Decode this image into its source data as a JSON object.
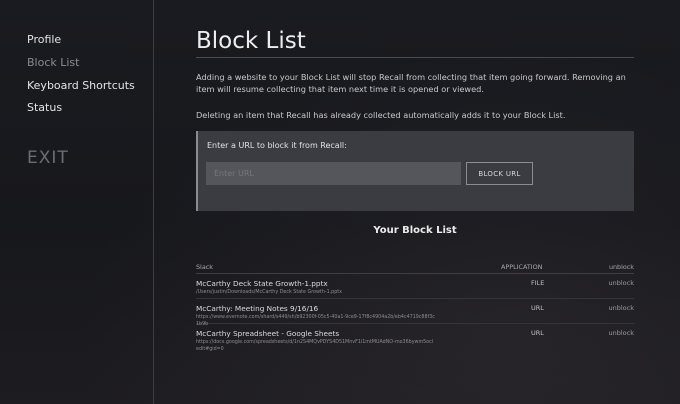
{
  "sidebar": {
    "items": [
      {
        "label": "Profile"
      },
      {
        "label": "Block List"
      },
      {
        "label": "Keyboard Shortcuts"
      },
      {
        "label": "Status"
      }
    ],
    "exit_label": "EXIT"
  },
  "main": {
    "title": "Block List",
    "description_1": "Adding a website to your Block List will stop Recall from collecting that item going forward. Removing an item will resume collecting that item next time it is opened or viewed.",
    "description_2": "Deleting an item that Recall has already collected automatically adds it to your Block List.",
    "url_prompt": "Enter a URL to block it from Recall:",
    "url_input": {
      "value": "",
      "placeholder": "Enter URL"
    },
    "block_button_label": "BLOCK URL",
    "list_heading": "Your Block List",
    "columns": {
      "name": "Slack",
      "type": "APPLICATION",
      "action": "unblock"
    },
    "rows": [
      {
        "title": "McCarthy Deck State Growth-1.pptx",
        "path": "/Users/justin/Downloads/McCarthy Deck State Growth-1.pptx",
        "type": "FILE",
        "action": "unblock"
      },
      {
        "title": "McCarthy: Meeting Notes 9/16/16",
        "path": "https://www.evernote.com/shard/s449/sh/b92300f-05c5-40a1-9ce9-17f8c4904a2b/eb4c4719c88f3c1b9b",
        "type": "URL",
        "action": "unblock"
      },
      {
        "title": "McCarthy Spreadsheet - Google Sheets",
        "path": "https://docs.google.com/spreadsheets/d/1n2S4MQvPDYS4D51MnvF1i1mtMUAdNO-mo36bywm5ocledit#gid=0",
        "type": "URL",
        "action": "unblock"
      }
    ]
  }
}
